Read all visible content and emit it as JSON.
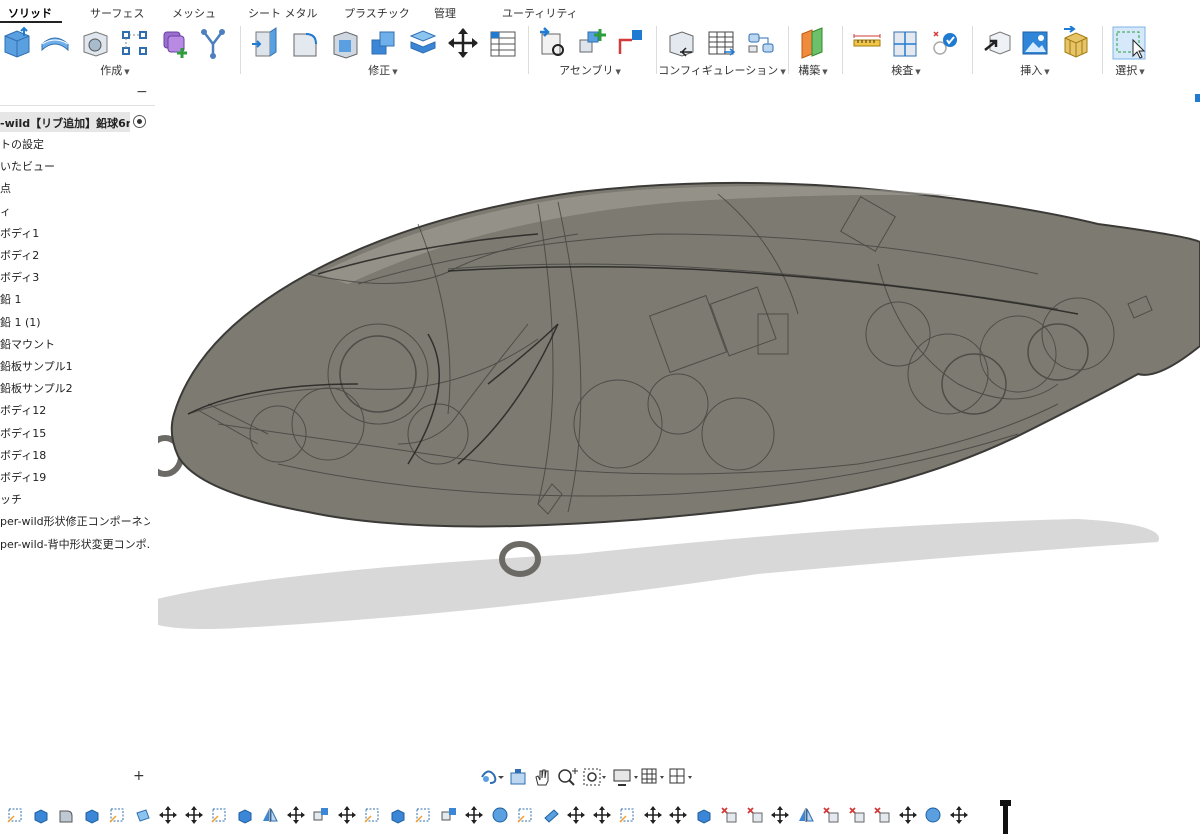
{
  "tabs": [
    "ソリッド",
    "サーフェス",
    "メッシュ",
    "シート メタル",
    "プラスチック",
    "管理",
    "ユーティリティ"
  ],
  "ribbon": {
    "groups": [
      {
        "label": "作成",
        "icons": [
          "new-component-icon",
          "extrude-icon",
          "revolve-icon",
          "sketch-pattern-icon",
          "form-icon",
          "derive-icon"
        ]
      },
      {
        "label": "修正",
        "icons": [
          "press-pull-icon",
          "fillet-icon",
          "shell-icon",
          "combine-icon",
          "stack-icon",
          "move-icon",
          "parameters-icon"
        ]
      },
      {
        "label": "アセンブリ",
        "icons": [
          "joint-icon",
          "new-component-icon-2",
          "joint-origin-icon"
        ]
      },
      {
        "label": "コンフィギュレーション",
        "icons": [
          "configure-icon",
          "config-table-icon",
          "config-rule-icon"
        ]
      },
      {
        "label": "構築",
        "icons": [
          "offset-plane-icon"
        ]
      },
      {
        "label": "検査",
        "icons": [
          "measure-icon",
          "section-analysis-icon",
          "interference-icon"
        ]
      },
      {
        "label": "挿入",
        "icons": [
          "insert-derive-icon",
          "insert-canvas-icon",
          "insert-mesh-icon"
        ]
      },
      {
        "label": "選択",
        "icons": [
          "window-select-icon"
        ]
      }
    ]
  },
  "browser": {
    "collapse": "−",
    "root": "-wild【リブ追加】鉛球6n...",
    "items": [
      "トの設定",
      "いたビュー",
      "点",
      "ィ",
      "ボディ1",
      "ボディ2",
      "ボディ3",
      "鉛 1",
      "鉛 1 (1)",
      "鉛マウント",
      "鉛板サンプル1",
      "鉛板サンプル2",
      "ボディ12",
      "ボディ15",
      "ボディ18",
      "ボディ19",
      "ッチ",
      "per-wild形状修正コンポーネン...",
      "per-wild-背中形状変更コンポ..."
    ],
    "add": "+"
  },
  "colors": {
    "body_fill": "#7d7a72",
    "body_shadow": "#d9d9d9",
    "accent_blue": "#1f7ad1",
    "accent_green": "#2e9e3a"
  },
  "navbar": {
    "icons": [
      "orbit-icon",
      "look-at-icon",
      "pan-icon",
      "zoom-icon",
      "fit-icon",
      "display-settings-icon",
      "grid-icon",
      "viewports-icon"
    ]
  },
  "timeline": {
    "icons": [
      "sketch-icon",
      "extrude-icon",
      "fillet-icon",
      "extrude-icon",
      "sketch-icon",
      "plane-icon",
      "move-icon",
      "move-icon",
      "sketch-icon",
      "extrude-icon",
      "mirror-icon",
      "move-icon",
      "joint-icon",
      "move-icon",
      "sketch-icon",
      "extrude-icon",
      "sketch-icon",
      "joint-icon",
      "move-icon",
      "sphere-icon",
      "sketch-icon",
      "cylinder-icon",
      "move-icon",
      "move-icon",
      "sketch-icon",
      "move-icon",
      "move-icon",
      "extrude-icon",
      "remove-icon",
      "remove-icon",
      "move-icon",
      "mirror-icon",
      "remove-icon",
      "remove-icon",
      "remove-icon",
      "move-icon",
      "sphere-icon",
      "move-icon"
    ]
  }
}
